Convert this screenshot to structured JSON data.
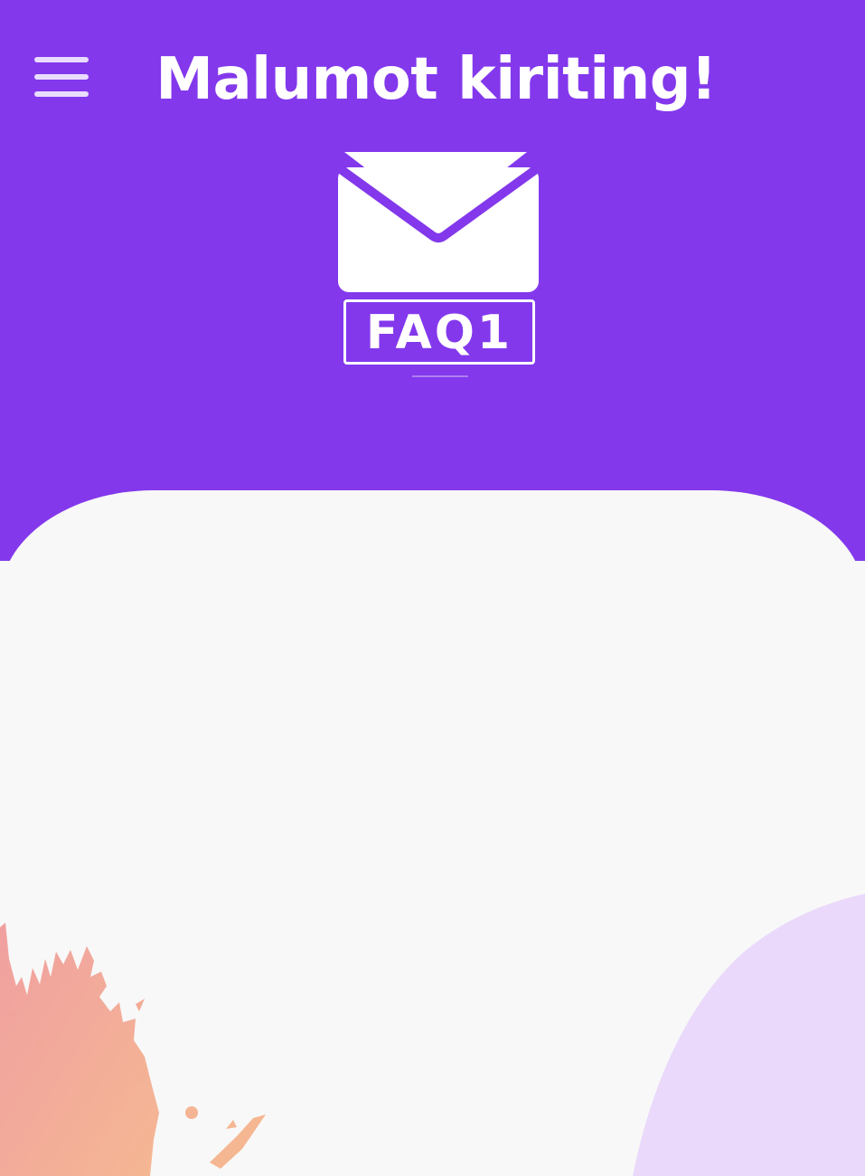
{
  "header": {
    "title": "Malumot kiriting!",
    "menu_icon": "hamburger-menu-icon",
    "background_color": "#8338ec"
  },
  "logo": {
    "icon": "envelope-icon",
    "text": "FAQ1"
  },
  "content": {
    "background_color": "#f8f8f8"
  },
  "decorations": {
    "left_splash_color": "#f3a38f",
    "right_blob_color": "#ead9fb"
  }
}
